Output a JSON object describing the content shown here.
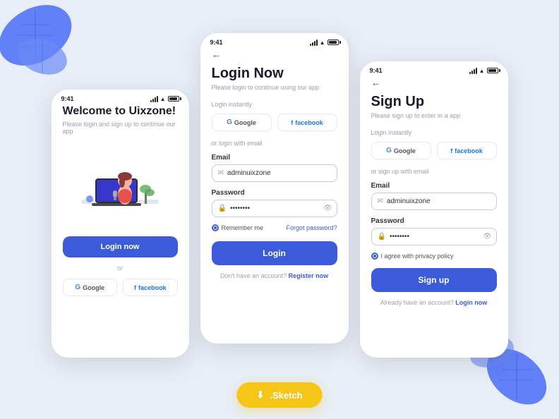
{
  "background": "#e8eef7",
  "accent": "#3b5bdb",
  "phones": {
    "left": {
      "status_time": "9:41",
      "title": "Welcome to Uixzone!",
      "subtitle": "Please login and sign up to continue our app",
      "login_btn": "Login now",
      "or_text": "or",
      "google_label": "Google",
      "facebook_label": "facebook"
    },
    "center": {
      "status_time": "9:41",
      "back_arrow": "←",
      "title": "Login Now",
      "subtitle": "Please login to continue using our app",
      "section_login": "Login instantly",
      "google_label": "Google",
      "facebook_label": "facebook",
      "divider": "or login with email",
      "email_label": "Email",
      "email_placeholder": "adminuixzone",
      "password_label": "Password",
      "password_value": "••••••••",
      "remember_label": "Remember me",
      "forgot_label": "Forgot password?",
      "login_btn": "Login",
      "bottom_text": "Don't have an account?",
      "register_link": "Register now"
    },
    "right": {
      "status_time": "9:41",
      "back_arrow": "←",
      "title": "Sign Up",
      "subtitle": "Please sign up to enter in a app",
      "section_login": "Login instantly",
      "google_label": "Google",
      "facebook_label": "facebook",
      "divider": "or sign up with email",
      "email_label": "Email",
      "email_placeholder": "adminuixzone",
      "password_label": "Password",
      "password_value": "••••••••",
      "agree_label": "I agree with privacy policy",
      "signup_btn": "Sign up",
      "bottom_text": "Already have an account?",
      "login_link": "Login now"
    }
  },
  "sketch_btn": {
    "icon": "⬇",
    "label": ".Sketch"
  }
}
